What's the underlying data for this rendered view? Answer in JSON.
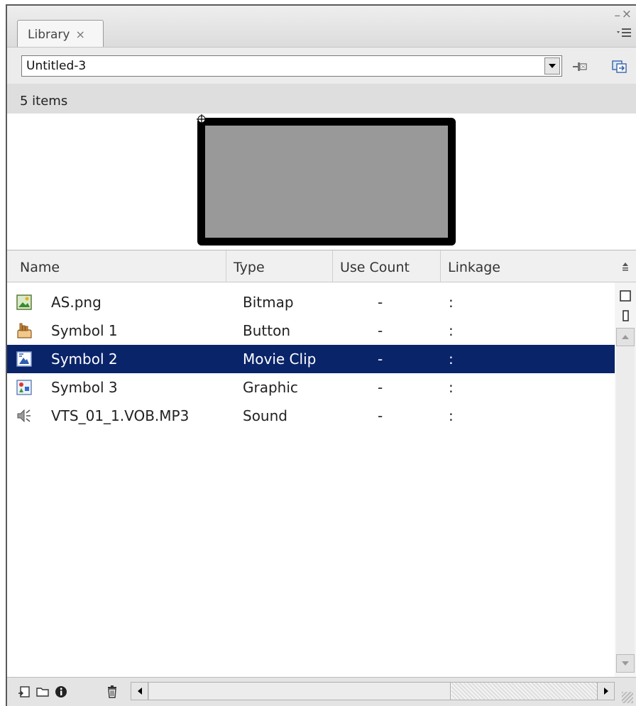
{
  "panel": {
    "tab_label": "Library",
    "tab_close": "×",
    "window_minimize": "–",
    "window_close": "×"
  },
  "document_selector": {
    "value": "Untitled-3"
  },
  "item_count": "5 items",
  "list": {
    "columns": [
      "Name",
      "Type",
      "Use Count",
      "Linkage"
    ],
    "items": [
      {
        "name": "AS.png",
        "type": "Bitmap",
        "use_count": "-",
        "linkage": ":",
        "icon": "bitmap-icon"
      },
      {
        "name": "Symbol 1",
        "type": "Button",
        "use_count": "-",
        "linkage": ":",
        "icon": "button-symbol-icon"
      },
      {
        "name": "Symbol 2",
        "type": "Movie Clip",
        "use_count": "-",
        "linkage": ":",
        "icon": "movie-clip-icon",
        "selected": true
      },
      {
        "name": "Symbol 3",
        "type": "Graphic",
        "use_count": "-",
        "linkage": ":",
        "icon": "graphic-symbol-icon"
      },
      {
        "name": "VTS_01_1.VOB.MP3",
        "type": "Sound",
        "use_count": "-",
        "linkage": ":",
        "icon": "sound-icon"
      }
    ]
  },
  "colors": {
    "selection": "#0a246a",
    "panel_bg": "#e6e6e6",
    "preview_fill": "#999999",
    "preview_stroke": "#000000"
  }
}
